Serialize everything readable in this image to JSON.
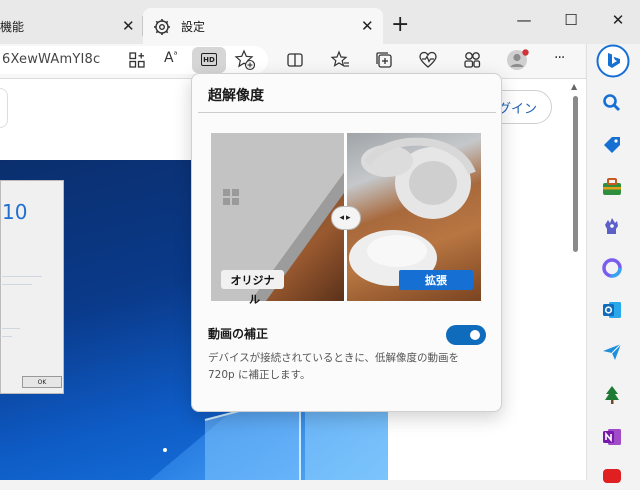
{
  "tabs": [
    {
      "label": "機能",
      "active": false
    },
    {
      "label": "設定",
      "active": true
    }
  ],
  "tab_close_glyph": "✕",
  "new_tab_glyph": "+",
  "window_controls": {
    "minimize": "—",
    "maximize": "☐",
    "close": "✕"
  },
  "address": {
    "text": "6XewWAmYI8c"
  },
  "toolbar": {
    "hd_label": "HD",
    "icons": [
      "grid-apps-icon",
      "read-aloud-icon",
      "hd-icon",
      "add-favorite-icon",
      "split-screen-icon",
      "favorites-icon",
      "collections-icon",
      "browser-essentials-icon",
      "extensions-icon",
      "profile-icon",
      "more-icon",
      "bing-icon"
    ]
  },
  "toolbar_glyphs": {
    "readaloud": "A",
    "more": "···"
  },
  "page": {
    "signin_label": "グイン"
  },
  "video_dialog": {
    "heading": "10",
    "ok_label": "OK"
  },
  "popup": {
    "title": "超解像度",
    "comparison": {
      "original_label": "オリジナ",
      "original_label_wrap": "ル",
      "enhanced_label": "拡張",
      "handle_glyph": "◂▸"
    },
    "video_correction": {
      "title": "動画の補正",
      "description": "デバイスが接続されているときに、低解像度の動画を 720p に補正します。",
      "toggle_on": true
    }
  },
  "sidebar": {
    "icons": [
      "search-icon",
      "shopping-tag-icon",
      "tools-icon",
      "games-icon",
      "copilot-icon",
      "outlook-icon",
      "send-icon",
      "tree-icon",
      "onenote-icon",
      "youtube-icon"
    ]
  },
  "colors": {
    "accent": "#0f6cbd",
    "enhanced_badge": "#1670d4",
    "video_blue": "#0e5bc5"
  }
}
